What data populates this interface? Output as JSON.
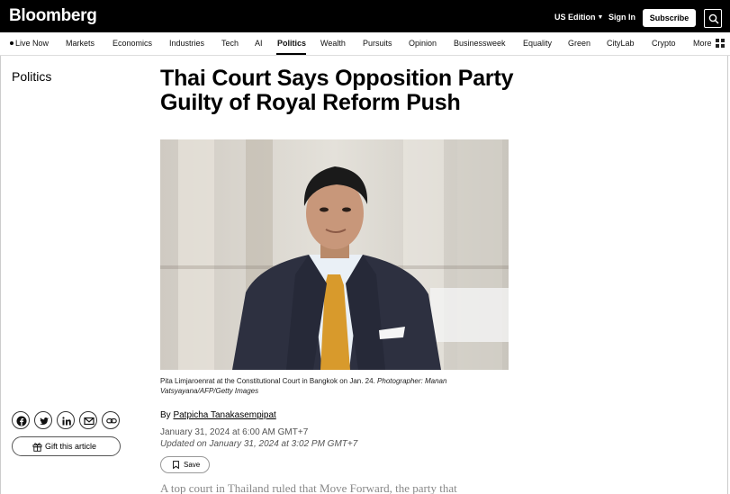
{
  "header": {
    "logo": "Bloomberg",
    "edition_label": "US Edition",
    "signin_label": "Sign In",
    "subscribe_label": "Subscribe",
    "search_icon": "search-icon"
  },
  "nav": {
    "items": [
      {
        "label": "Live Now"
      },
      {
        "label": "Markets"
      },
      {
        "label": "Economics"
      },
      {
        "label": "Industries"
      },
      {
        "label": "Tech"
      },
      {
        "label": "AI"
      },
      {
        "label": "Politics",
        "active": true
      },
      {
        "label": "Wealth"
      },
      {
        "label": "Pursuits"
      },
      {
        "label": "Opinion"
      },
      {
        "label": "Businessweek"
      },
      {
        "label": "Equality"
      },
      {
        "label": "Green"
      },
      {
        "label": "CityLab"
      },
      {
        "label": "Crypto"
      },
      {
        "label": "More"
      }
    ]
  },
  "article": {
    "section": "Politics",
    "headline": "Thai Court Says Opposition Party Guilty of Royal Reform Push",
    "caption_text": "Pita Limjaroenrat at the Constitutional Court in Bangkok on Jan. 24.",
    "caption_credit": "Photographer: Manan Vatsyayana/AFP/Getty Images",
    "byline_prefix": "By",
    "author": "Patpicha Tanakasempipat",
    "published": "January 31, 2024 at 6:00 AM GMT+7",
    "updated": "Updated on January 31, 2024 at 3:02 PM GMT+7",
    "save_label": "Save",
    "teaser": "A top court in Thailand ruled that Move Forward, the party that"
  },
  "share": {
    "gift_label": "Gift this article",
    "icons": [
      "facebook-icon",
      "twitter-icon",
      "linkedin-icon",
      "email-icon",
      "link-icon"
    ]
  },
  "colors": {
    "header_bg": "#000000",
    "text": "#000000",
    "muted": "#555555"
  }
}
